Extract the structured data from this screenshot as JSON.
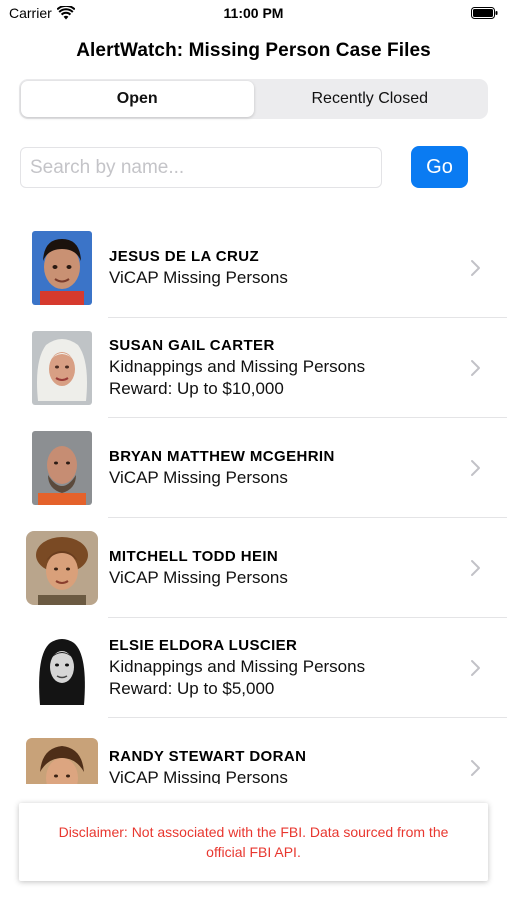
{
  "status_bar": {
    "carrier": "Carrier",
    "time": "11:00 PM"
  },
  "header": {
    "title": "AlertWatch: Missing Person Case Files"
  },
  "tabs": [
    {
      "label": "Open",
      "selected": true
    },
    {
      "label": "Recently Closed",
      "selected": false
    }
  ],
  "search": {
    "placeholder": "Search by name...",
    "value": "",
    "go_label": "Go"
  },
  "cases": [
    {
      "name": "JESUS DE LA CRUZ",
      "category": "ViCAP Missing Persons",
      "reward": ""
    },
    {
      "name": "SUSAN GAIL CARTER",
      "category": "Kidnappings and Missing Persons",
      "reward": "Reward: Up to $10,000"
    },
    {
      "name": "BRYAN MATTHEW MCGEHRIN",
      "category": "ViCAP Missing Persons",
      "reward": ""
    },
    {
      "name": "MITCHELL TODD HEIN",
      "category": "ViCAP Missing Persons",
      "reward": ""
    },
    {
      "name": "ELSIE ELDORA LUSCIER",
      "category": "Kidnappings and Missing Persons",
      "reward": "Reward: Up to $5,000"
    },
    {
      "name": "RANDY STEWART DORAN",
      "category": "ViCAP Missing Persons",
      "reward": ""
    }
  ],
  "disclaimer": {
    "text": "Disclaimer: Not associated with the FBI. Data sourced from the official FBI API."
  },
  "colors": {
    "accent": "#0a7bf2",
    "disclaimer_text": "#e8372f"
  }
}
